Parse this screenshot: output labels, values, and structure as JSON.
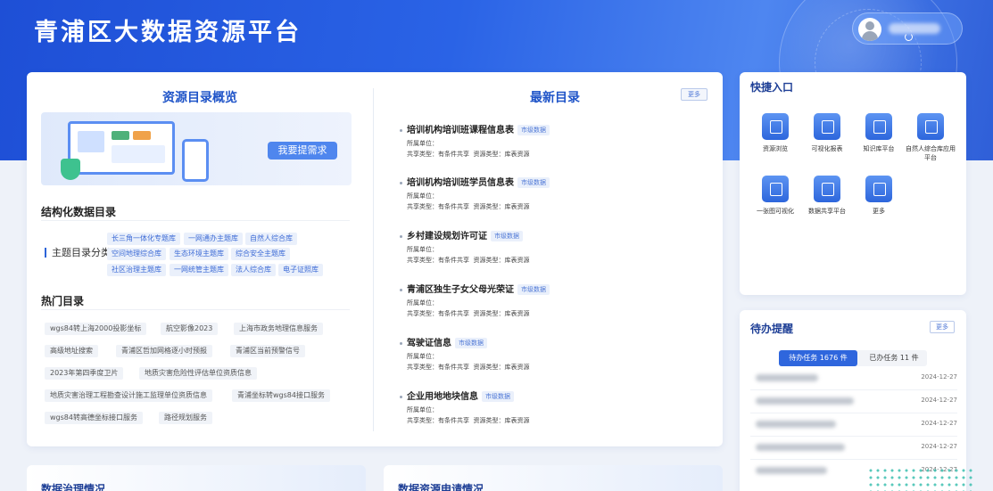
{
  "header": {
    "title": "青浦区大数据资源平台"
  },
  "overview": {
    "title": "资源目录概览",
    "request_button": "我要提需求",
    "structured_title": "结构化数据目录",
    "category_label": "主题目录分类",
    "tags": [
      "长三角一体化专题库",
      "一网通办主题库",
      "自然人综合库",
      "空间地理综合库",
      "生态环境主题库",
      "综合安全主题库",
      "社区治理主题库",
      "一网统管主题库",
      "法人综合库",
      "电子证照库"
    ],
    "hot_title": "热门目录",
    "hot_items": [
      "wgs84转上海2000投影坐标",
      "航空影像2023",
      "上海市政务地理信息服务",
      "高级地址搜索",
      "青浦区哲加网格逐小时预报",
      "青浦区当前预警信号",
      "2023年第四季度卫片",
      "地质灾害危险性评估单位资质信息",
      "地质灾害治理工程勘查设计施工监理单位资质信息",
      "青浦坐标转wgs84接口服务",
      "wgs84转高德坐标接口服务",
      "路径规划服务"
    ]
  },
  "latest": {
    "title": "最新目录",
    "more": "更多",
    "owner_label": "所属单位：",
    "share_label": "共享类型：有条件共享",
    "resource_label": "资源类型：库表资源",
    "items": [
      {
        "name": "培训机构培训班课程信息表",
        "level": "市级数据"
      },
      {
        "name": "培训机构培训班学员信息表",
        "level": "市级数据"
      },
      {
        "name": "乡村建设规划许可证",
        "level": "市级数据"
      },
      {
        "name": "青浦区独生子女父母光荣证",
        "level": "市级数据"
      },
      {
        "name": "驾驶证信息",
        "level": "市级数据"
      },
      {
        "name": "企业用地地块信息",
        "level": "市级数据"
      }
    ]
  },
  "bottom": {
    "left_title": "数据治理情况",
    "right_title": "数据资源申请情况"
  },
  "quick": {
    "title": "快捷入口",
    "items": [
      "资源浏览",
      "可视化报表",
      "知识库平台",
      "自然人综合库应用平台",
      "一张图可视化",
      "数据共享平台",
      "更多"
    ]
  },
  "todo": {
    "title": "待办提醒",
    "more": "更多",
    "tab_pending": "待办任务 1676 件",
    "tab_done": "已办任务 11 件",
    "dates": [
      "2024-12-27",
      "2024-12-27",
      "2024-12-27",
      "2024-12-27",
      "2024-12-27"
    ]
  }
}
